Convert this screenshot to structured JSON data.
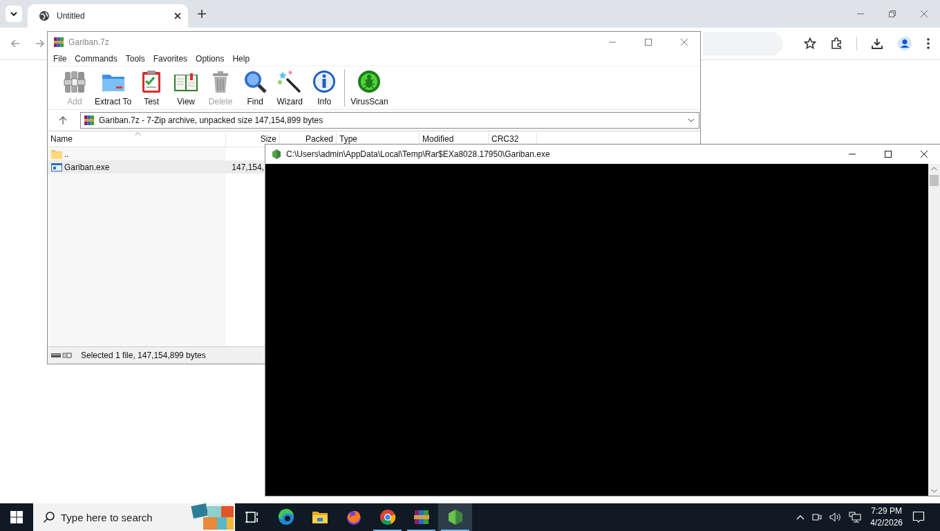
{
  "browser": {
    "tabs": [
      {
        "title": "Untitled",
        "selected": true
      }
    ]
  },
  "archiver": {
    "title": "Gariban.7z",
    "menu": [
      "File",
      "Commands",
      "Tools",
      "Favorites",
      "Options",
      "Help"
    ],
    "toolbar": [
      {
        "label": "Add",
        "kind": "add",
        "disabled": true
      },
      {
        "label": "Extract To",
        "kind": "extract",
        "disabled": false
      },
      {
        "label": "Test",
        "kind": "test",
        "disabled": false
      },
      {
        "label": "View",
        "kind": "view",
        "disabled": false
      },
      {
        "label": "Delete",
        "kind": "delete",
        "disabled": true
      },
      {
        "label": "Find",
        "kind": "find",
        "disabled": false
      },
      {
        "label": "Wizard",
        "kind": "wizard",
        "disabled": false
      },
      {
        "label": "Info",
        "kind": "info",
        "disabled": false
      },
      {
        "label": "VirusScan",
        "kind": "virusscan",
        "disabled": false
      }
    ],
    "path": "Gariban.7z - 7-Zip archive, unpacked size 147,154,899 bytes",
    "columns": [
      "Name",
      "Size",
      "Packed",
      "Type",
      "Modified",
      "CRC32"
    ],
    "rows": [
      {
        "kind": "folder",
        "name": "..",
        "selected": false
      },
      {
        "kind": "exe",
        "name": "Gariban.exe",
        "size": "147,154,",
        "selected": true
      }
    ],
    "status": "Selected 1 file, 147,154,899 bytes"
  },
  "console": {
    "title": "C:\\Users\\admin\\AppData\\Local\\Temp\\Rar$EXa8028.17950\\Gariban.exe"
  },
  "taskbar": {
    "search_placeholder": "Type here to search",
    "apps": [
      {
        "kind": "taskview",
        "running": false,
        "selected": false
      },
      {
        "kind": "edge",
        "running": false,
        "selected": false
      },
      {
        "kind": "explorer",
        "running": false,
        "selected": false
      },
      {
        "kind": "firefox",
        "running": false,
        "selected": false
      },
      {
        "kind": "chrome",
        "running": true,
        "selected": false
      },
      {
        "kind": "winrar",
        "running": true,
        "selected": false
      },
      {
        "kind": "node",
        "running": true,
        "selected": true
      }
    ],
    "time": "7:29 PM",
    "date": "4/2/2026"
  }
}
